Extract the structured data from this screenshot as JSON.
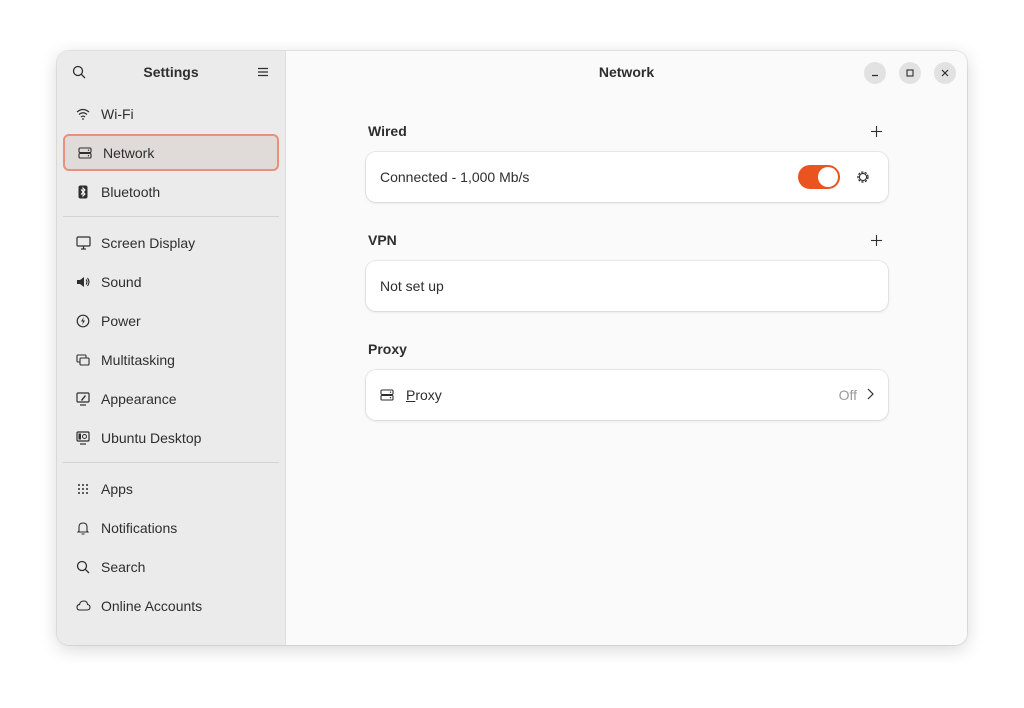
{
  "sidebar": {
    "title": "Settings",
    "groups": [
      [
        {
          "label": "Wi-Fi",
          "icon": "wifi-icon"
        },
        {
          "label": "Network",
          "icon": "network-icon",
          "active": true
        },
        {
          "label": "Bluetooth",
          "icon": "bluetooth-icon"
        }
      ],
      [
        {
          "label": "Screen Display",
          "icon": "display-icon"
        },
        {
          "label": "Sound",
          "icon": "sound-icon"
        },
        {
          "label": "Power",
          "icon": "power-icon"
        },
        {
          "label": "Multitasking",
          "icon": "multitasking-icon"
        },
        {
          "label": "Appearance",
          "icon": "appearance-icon"
        },
        {
          "label": "Ubuntu Desktop",
          "icon": "ubuntu-desktop-icon"
        }
      ],
      [
        {
          "label": "Apps",
          "icon": "apps-icon"
        },
        {
          "label": "Notifications",
          "icon": "bell-icon"
        },
        {
          "label": "Search",
          "icon": "search-icon"
        },
        {
          "label": "Online Accounts",
          "icon": "cloud-icon"
        }
      ]
    ]
  },
  "main": {
    "title": "Network",
    "wired": {
      "heading": "Wired",
      "status": "Connected - 1,000 Mb/s",
      "enabled": true
    },
    "vpn": {
      "heading": "VPN",
      "status": "Not set up"
    },
    "proxy": {
      "heading": "Proxy",
      "label_first": "P",
      "label_rest": "roxy",
      "value": "Off"
    }
  },
  "colors": {
    "accent": "#e95420",
    "active_border": "#e8917a",
    "sidebar_bg": "#ebebeb"
  }
}
